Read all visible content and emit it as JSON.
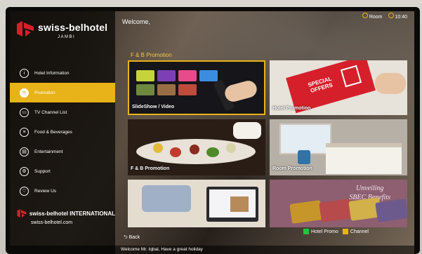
{
  "brand": {
    "name": "swiss-belhotel",
    "location": "JAMBI",
    "footer_name": "swiss-belhotel INTERNATIONAL",
    "footer_url": "swiss-belhotel.com",
    "accent_color": "#e8b318",
    "logo_color": "#d5202b"
  },
  "header": {
    "welcome": "Welcome,",
    "room_label": "Room",
    "time": "10:40"
  },
  "sidebar": {
    "items": [
      {
        "label": "Hotel Information",
        "icon": "info-icon",
        "active": false
      },
      {
        "label": "Promotion",
        "icon": "promotion-icon",
        "active": true
      },
      {
        "label": "TV Channel List",
        "icon": "tv-icon",
        "active": false
      },
      {
        "label": "Food & Beverages",
        "icon": "food-icon",
        "active": false
      },
      {
        "label": "Entertainment",
        "icon": "entertainment-icon",
        "active": false
      },
      {
        "label": "Support",
        "icon": "support-icon",
        "active": false
      },
      {
        "label": "Review Us",
        "icon": "review-icon",
        "active": false
      }
    ]
  },
  "main": {
    "section_title": "F & B Promotion",
    "tiles": [
      {
        "caption": "SlideShow / Video"
      },
      {
        "caption": "Hotel Promotion",
        "badge": "SPECIAL OFFERS"
      },
      {
        "caption": "F & B Promotion"
      },
      {
        "caption": "Room Promotion"
      },
      {
        "caption": ""
      },
      {
        "caption": "",
        "heading_1": "Unveiling",
        "heading_2": "SBEC Benefits"
      }
    ]
  },
  "legend": {
    "items": [
      {
        "label": "Hotel Promo",
        "color": "#2bbf3a"
      },
      {
        "label": "Channel",
        "color": "#e8b318"
      }
    ]
  },
  "footer": {
    "back_label": "Back",
    "ticker": "Welcome Mr. Iqbal, Have a great holiday"
  }
}
